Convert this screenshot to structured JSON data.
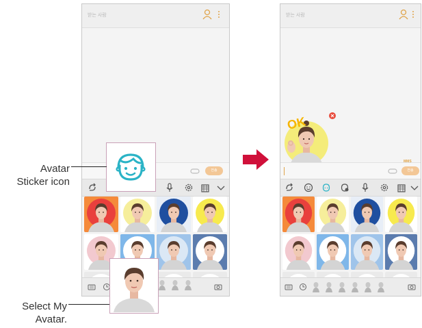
{
  "callouts": {
    "avatar_sticker": "Avatar\nSticker icon",
    "select_avatar": "Select My\nAvatar."
  },
  "left_phone": {
    "to_placeholder": "받는 사람",
    "send_label": "전송"
  },
  "right_phone": {
    "to_placeholder": "받는 사람",
    "send_label": "전송",
    "attachment_badge": "MMS",
    "sticker_text": "OK"
  },
  "colors": {
    "accent": "#e0a44a",
    "avatar_icon": "#2ab3c6",
    "callout_border": "#c9a0b7",
    "arrow": "#d0103a"
  },
  "icons": {
    "toolbar_left": [
      "swype-icon",
      "mic-icon",
      "gear-icon",
      "clipboard-icon",
      "chevron-down-icon"
    ],
    "toolbar_right": [
      "swype-icon",
      "emoji-icon",
      "avatar-sticker-icon",
      "avatar-sticker-alt-icon",
      "mic-icon",
      "gear-icon",
      "clipboard-icon",
      "chevron-down-icon"
    ],
    "bottom_bar": [
      "keyboard-icon",
      "recent-icon",
      "camera-icon"
    ]
  }
}
